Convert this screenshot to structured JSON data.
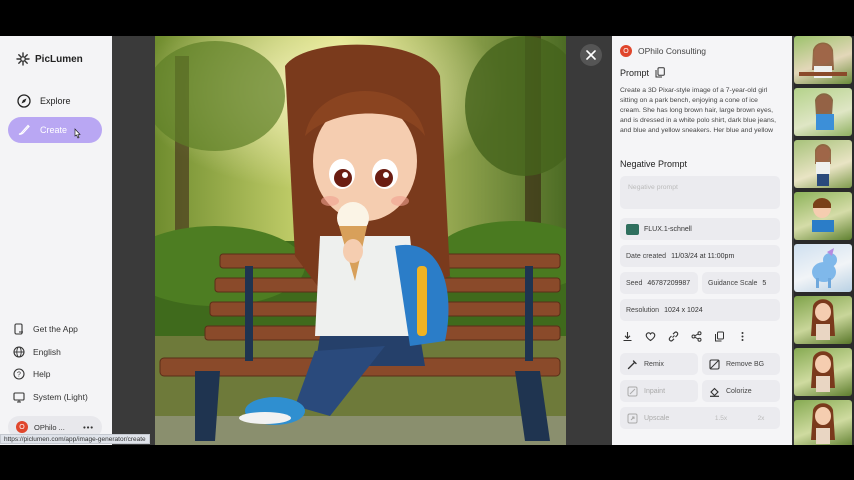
{
  "app": {
    "brand": "PicLumen"
  },
  "sidebar": {
    "items": [
      {
        "label": "Explore",
        "icon": "compass-icon"
      },
      {
        "label": "Create",
        "icon": "brush-icon",
        "active": true
      }
    ],
    "bottom": [
      {
        "label": "Get the App",
        "icon": "phone-icon"
      },
      {
        "label": "English",
        "icon": "globe-icon"
      },
      {
        "label": "Help",
        "icon": "help-icon"
      },
      {
        "label": "System (Light)",
        "icon": "monitor-icon"
      }
    ],
    "account": {
      "initial": "O",
      "name": "OPhilo ..."
    }
  },
  "details": {
    "author_initial": "O",
    "author": "OPhilo Consulting",
    "prompt_title": "Prompt",
    "prompt_text": "Create a 3D Pixar-style image of a 7-year-old girl sitting on a park bench, enjoying a cone of ice cream. She has long brown hair, large brown eyes, and is dressed in a white polo shirt, dark blue jeans, and blue and yellow sneakers. Her blue and yellow",
    "negative_title": "Negative Prompt",
    "negative_placeholder": "Negative prompt",
    "model": "FLUX.1-schnell",
    "date_label": "Date created",
    "date_value": "11/03/24 at 11:00pm",
    "seed_label": "Seed",
    "seed_value": "46787209987",
    "guidance_label": "Guidance Scale",
    "guidance_value": "5",
    "resolution_label": "Resolution",
    "resolution_value": "1024 x 1024",
    "tools": {
      "remix": "Remix",
      "remove_bg": "Remove BG",
      "inpaint": "Inpaint",
      "colorize": "Colorize",
      "upscale": "Upscale",
      "upscale_1": "1.5x",
      "upscale_2": "2x"
    }
  },
  "status_url": "https://piclumen.com/app/image-generator/create",
  "colors": {
    "accent": "#b9a7f3",
    "avatar": "#e0462c"
  }
}
